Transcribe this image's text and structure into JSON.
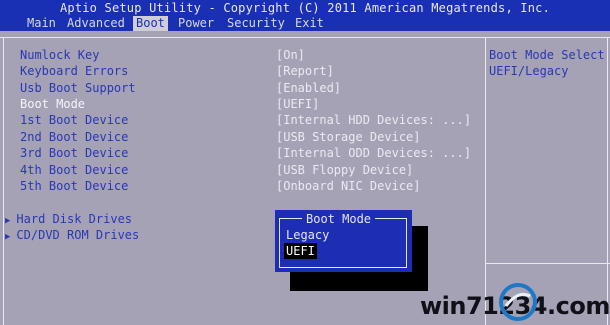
{
  "title": "Aptio Setup Utility - Copyright (C) 2011 American Megatrends, Inc.",
  "tabs": [
    "Main",
    "Advanced",
    "Boot",
    "Power",
    "Security",
    "Exit"
  ],
  "active_tab": "Boot",
  "settings": [
    {
      "label": "Numlock Key",
      "value": "[On]"
    },
    {
      "label": "Keyboard Errors",
      "value": "[Report]"
    },
    {
      "label": "Usb Boot Support",
      "value": "[Enabled]"
    },
    {
      "label": "Boot Mode",
      "value": "[UEFI]"
    },
    {
      "label": "1st Boot Device",
      "value": "[Internal HDD Devices: ...]"
    },
    {
      "label": "2nd Boot Device",
      "value": "[USB Storage Device]"
    },
    {
      "label": "3rd Boot Device",
      "value": "[Internal ODD Devices: ...]"
    },
    {
      "label": "4th Boot Device",
      "value": "[USB Floppy Device]"
    },
    {
      "label": "5th Boot Device",
      "value": "[Onboard NIC Device]"
    }
  ],
  "submenus": [
    "Hard Disk Drives",
    "CD/DVD ROM Drives"
  ],
  "help": {
    "line1": "Boot Mode Select",
    "line2": "UEFI/Legacy"
  },
  "popup": {
    "title": "Boot Mode",
    "options": [
      "Legacy",
      "UEFI"
    ],
    "selected": "UEFI"
  },
  "watermark": "win71234.com",
  "colors": {
    "header": "#1a30b4",
    "panel": "#a5a2b5",
    "highlight": "#f4f4fa",
    "popup": "#1d2db4"
  }
}
